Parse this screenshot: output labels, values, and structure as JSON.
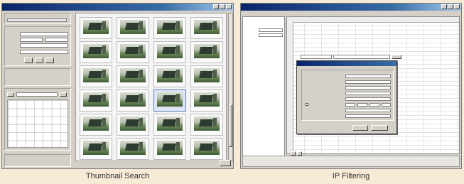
{
  "captions": {
    "left": "Thumbnail Search",
    "right": "IP Filtering"
  },
  "thumbnail_window": {
    "grid": {
      "rows": 6,
      "cols": 4,
      "selected_row": 3,
      "selected_col": 2
    }
  },
  "ip_window": {},
  "colors": {
    "background": "#f7ead6",
    "title_bar": "#0a246a",
    "window_face": "#d4d0c8"
  }
}
